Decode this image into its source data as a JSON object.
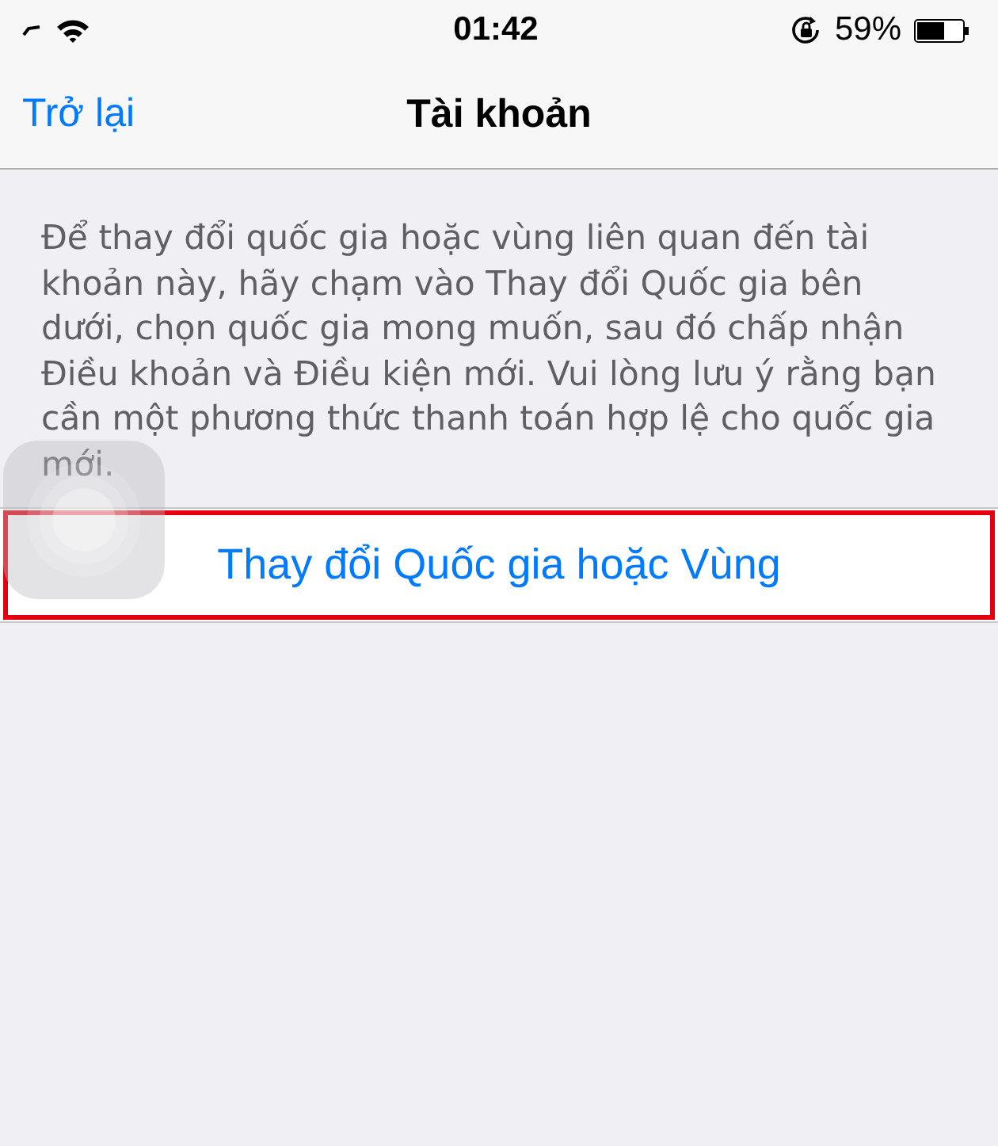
{
  "status_bar": {
    "time": "01:42",
    "battery": "59%"
  },
  "nav_bar": {
    "back": "Trở lại",
    "title": "Tài khoản"
  },
  "description": "Để thay đổi quốc gia hoặc vùng liên quan đến tài khoản này, hãy chạm vào Thay đổi Quốc gia bên dưới, chọn quốc gia mong muốn, sau đó chấp nhận Điều khoản và Điều kiện mới. Vui lòng lưu ý rằng bạn cần một phương thức thanh toán hợp lệ cho quốc gia mới.",
  "action_row": {
    "label": "Thay đổi Quốc gia hoặc Vùng",
    "highlighted": true
  }
}
